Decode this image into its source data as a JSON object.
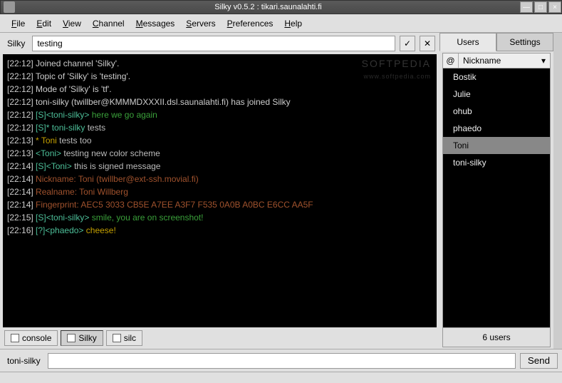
{
  "window": {
    "title": "Silky v0.5.2 : tikari.saunalahti.fi"
  },
  "menu": {
    "file": "File",
    "edit": "Edit",
    "view": "View",
    "channel": "Channel",
    "messages": "Messages",
    "servers": "Servers",
    "preferences": "Preferences",
    "help": "Help"
  },
  "topic": {
    "label": "Silky",
    "value": "testing"
  },
  "sidebar": {
    "tabs": {
      "users": "Users",
      "settings": "Settings"
    },
    "header_at": "@",
    "header_nick": "Nickname",
    "users": [
      "Bostik",
      "Julie",
      "ohub",
      "phaedo",
      "Toni",
      "toni-silky"
    ],
    "selected_index": 4,
    "count_label": "6 users"
  },
  "bottom_tabs": {
    "console": "console",
    "silky": "Silky",
    "silc": "silc"
  },
  "input": {
    "nick": "toni-silky",
    "send": "Send",
    "value": ""
  },
  "watermark": {
    "main": "SOFTPEDIA",
    "sub": "www.softpedia.com"
  },
  "chat": [
    {
      "ts": "[22:12]",
      "segs": [
        {
          "cls": "sys",
          "t": " Joined channel 'Silky'."
        }
      ]
    },
    {
      "ts": "[22:12]",
      "segs": [
        {
          "cls": "sys",
          "t": " Topic of 'Silky' is 'testing'."
        }
      ]
    },
    {
      "ts": "[22:12]",
      "segs": [
        {
          "cls": "sys",
          "t": " Mode of 'Silky' is 'tf'."
        }
      ]
    },
    {
      "ts": "[22:12]",
      "segs": [
        {
          "cls": "sys",
          "t": " toni-silky (twillber@KMMMDXXXII.dsl.saunalahti.fi) has joined Silky"
        }
      ]
    },
    {
      "ts": "[22:12]",
      "segs": [
        {
          "cls": "teal",
          "t": " [S]<toni-silky>"
        },
        {
          "cls": "green",
          "t": " here we go again"
        }
      ]
    },
    {
      "ts": "[22:12]",
      "segs": [
        {
          "cls": "teal",
          "t": " [S]* toni-silky"
        },
        {
          "cls": "user",
          "t": " tests"
        }
      ]
    },
    {
      "ts": "[22:13]",
      "segs": [
        {
          "cls": "gold",
          "t": " * Toni"
        },
        {
          "cls": "user",
          "t": " tests too"
        }
      ]
    },
    {
      "ts": "[22:13]",
      "segs": [
        {
          "cls": "teal",
          "t": " <Toni>"
        },
        {
          "cls": "user",
          "t": " testing new color scheme"
        }
      ]
    },
    {
      "ts": "[22:14]",
      "segs": [
        {
          "cls": "teal",
          "t": " [S]<Toni>"
        },
        {
          "cls": "user",
          "t": " this is signed message"
        }
      ]
    },
    {
      "ts": "[22:14]",
      "segs": [
        {
          "cls": "brown",
          "t": " Nickname: Toni (twillber@ext-ssh.movial.fi)"
        }
      ]
    },
    {
      "ts": "[22:14]",
      "segs": [
        {
          "cls": "brown",
          "t": " Realname: Toni Willberg"
        }
      ]
    },
    {
      "ts": "[22:14]",
      "segs": [
        {
          "cls": "brown",
          "t": " Fingerprint: AEC5 3033 CB5E A7EE A3F7  F535 0A0B A0BC E6CC AA5F"
        }
      ]
    },
    {
      "ts": "[22:15]",
      "segs": [
        {
          "cls": "teal",
          "t": " [S]<toni-silky>"
        },
        {
          "cls": "green",
          "t": " smile, you are on screenshot!"
        }
      ]
    },
    {
      "ts": "[22:16]",
      "segs": [
        {
          "cls": "teal",
          "t": " [?]<phaedo>"
        },
        {
          "cls": "gold",
          "t": " cheese!"
        }
      ]
    }
  ]
}
